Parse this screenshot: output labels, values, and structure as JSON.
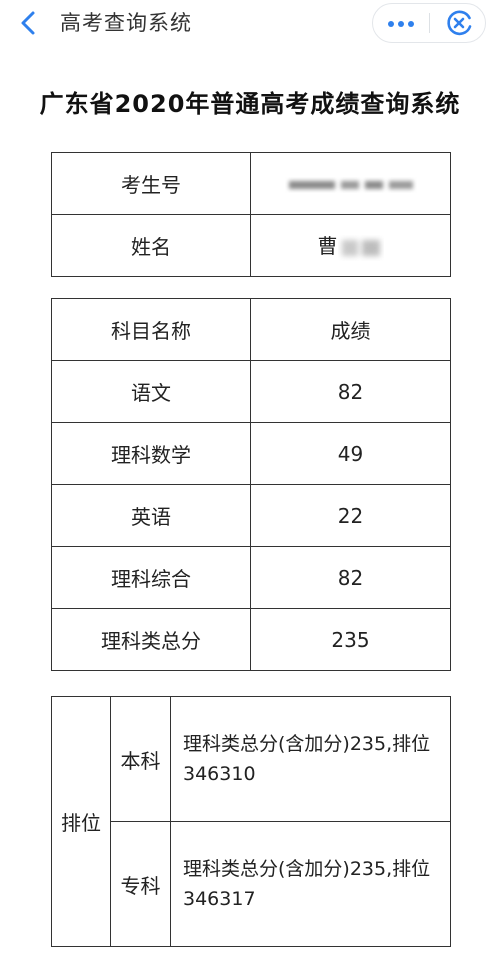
{
  "nav": {
    "title": "高考查询系统"
  },
  "page_title": "广东省2020年普通高考成绩查询系统",
  "student_info": {
    "exam_number_label": "考生号",
    "exam_number_value": "",
    "name_label": "姓名",
    "name_value_visible": "曹"
  },
  "scores": {
    "headers": [
      "科目名称",
      "成绩"
    ],
    "rows": [
      {
        "subject": "语文",
        "score": "82"
      },
      {
        "subject": "理科数学",
        "score": "49"
      },
      {
        "subject": "英语",
        "score": "22"
      },
      {
        "subject": "理科综合",
        "score": "82"
      },
      {
        "subject": "理科类总分",
        "score": "235"
      }
    ]
  },
  "ranking": {
    "label": "排位",
    "rows": [
      {
        "level": "本科",
        "detail": "理科类总分(含加分)235,排位346310"
      },
      {
        "level": "专科",
        "detail": "理科类总分(含加分)235,排位346317"
      }
    ]
  },
  "colors": {
    "accent": "#2f80ed",
    "border": "#333333"
  }
}
